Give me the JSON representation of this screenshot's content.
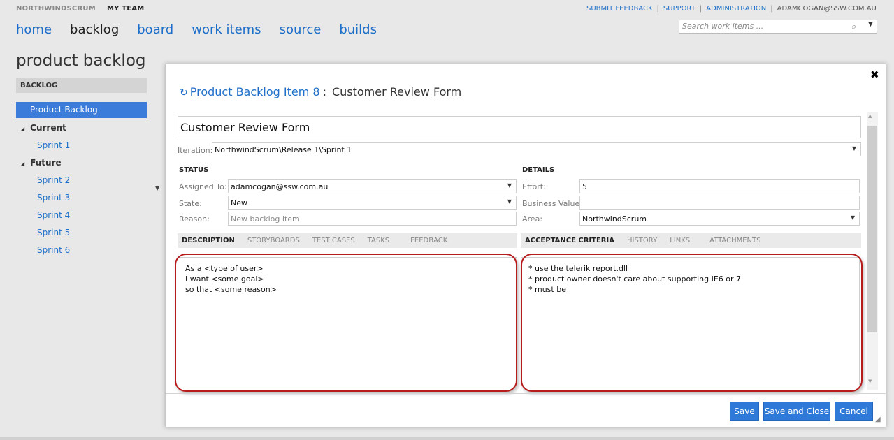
{
  "header": {
    "project": "NORTHWINDSCRUM",
    "team": "MY TEAM",
    "links": [
      "SUBMIT FEEDBACK",
      "SUPPORT",
      "ADMINISTRATION"
    ],
    "user": "ADAMCOGAN@SSW.COM.AU",
    "search_placeholder": "Search work items ..."
  },
  "nav": {
    "items": [
      "home",
      "backlog",
      "board",
      "work items",
      "source",
      "builds"
    ],
    "active": "backlog"
  },
  "sidebar": {
    "page_title": "product backlog",
    "section": "BACKLOG",
    "selected": "Product Backlog",
    "current_label": "Current",
    "current_items": [
      "Sprint 1"
    ],
    "future_label": "Future",
    "future_items": [
      "Sprint 2",
      "Sprint 3",
      "Sprint 4",
      "Sprint 5",
      "Sprint 6"
    ]
  },
  "dialog": {
    "type_label": "Product Backlog Item 8",
    "separator": ":",
    "name": "Customer Review Form",
    "title_value": "Customer Review Form",
    "iteration_label": "Iteration:",
    "iteration_value": "NorthwindScrum\\Release 1\\Sprint 1",
    "status": {
      "heading": "STATUS",
      "assigned_label": "Assigned To:",
      "assigned_value": "adamcogan@ssw.com.au",
      "state_label": "State:",
      "state_value": "New",
      "reason_label": "Reason:",
      "reason_placeholder": "New backlog item"
    },
    "details": {
      "heading": "DETAILS",
      "effort_label": "Effort:",
      "effort_value": "5",
      "business_value_label": "Business Value:",
      "business_value_value": "",
      "area_label": "Area:",
      "area_value": "NorthwindScrum"
    },
    "left_tabs": [
      "DESCRIPTION",
      "STORYBOARDS",
      "TEST CASES",
      "TASKS",
      "FEEDBACK"
    ],
    "right_tabs": [
      "ACCEPTANCE CRITERIA",
      "HISTORY",
      "LINKS",
      "ATTACHMENTS"
    ],
    "description_lines": [
      "As a <type of user>",
      "I want <some goal>",
      "so that <some reason>"
    ],
    "acceptance_lines": [
      "* use the telerik report.dll",
      "* product owner doesn't care about supporting IE6 or 7",
      "* must be"
    ],
    "buttons": {
      "save": "Save",
      "save_close": "Save and Close",
      "cancel": "Cancel"
    },
    "highlight_color": "#b71c1c",
    "accent_color": "#2f7ad8"
  }
}
